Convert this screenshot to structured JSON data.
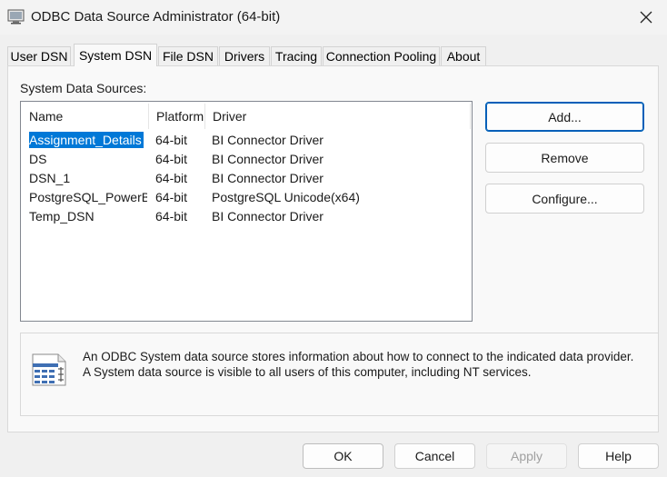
{
  "window": {
    "title": "ODBC Data Source Administrator (64-bit)",
    "app_icon": "odbc-admin-icon",
    "close_icon": "close-icon"
  },
  "tabs": [
    {
      "label": "User DSN",
      "active": false
    },
    {
      "label": "System DSN",
      "active": true
    },
    {
      "label": "File DSN",
      "active": false
    },
    {
      "label": "Drivers",
      "active": false
    },
    {
      "label": "Tracing",
      "active": false
    },
    {
      "label": "Connection Pooling",
      "active": false
    },
    {
      "label": "About",
      "active": false
    }
  ],
  "system_dsn": {
    "section_label": "System Data Sources:",
    "columns": [
      "Name",
      "Platform",
      "Driver"
    ],
    "rows": [
      {
        "name": "Assignment_Details",
        "platform": "64-bit",
        "driver": "BI Connector Driver",
        "selected": true
      },
      {
        "name": "DS",
        "platform": "64-bit",
        "driver": "BI Connector Driver",
        "selected": false
      },
      {
        "name": "DSN_1",
        "platform": "64-bit",
        "driver": "BI Connector Driver",
        "selected": false
      },
      {
        "name": "PostgreSQL_PowerBI",
        "platform": "64-bit",
        "driver": "PostgreSQL Unicode(x64)",
        "selected": false
      },
      {
        "name": "Temp_DSN",
        "platform": "64-bit",
        "driver": "BI Connector Driver",
        "selected": false
      }
    ],
    "buttons": {
      "add": "Add...",
      "remove": "Remove",
      "configure": "Configure..."
    },
    "info": {
      "icon": "data-source-icon",
      "line1": "An ODBC System data source stores information about how to connect to the indicated data provider.",
      "line2": "A System data source is visible to all users of this computer, including NT services."
    }
  },
  "footer": {
    "ok": "OK",
    "cancel": "Cancel",
    "apply": "Apply",
    "help": "Help"
  },
  "colors": {
    "selection": "#0078d7",
    "accent_border": "#005fb8"
  }
}
